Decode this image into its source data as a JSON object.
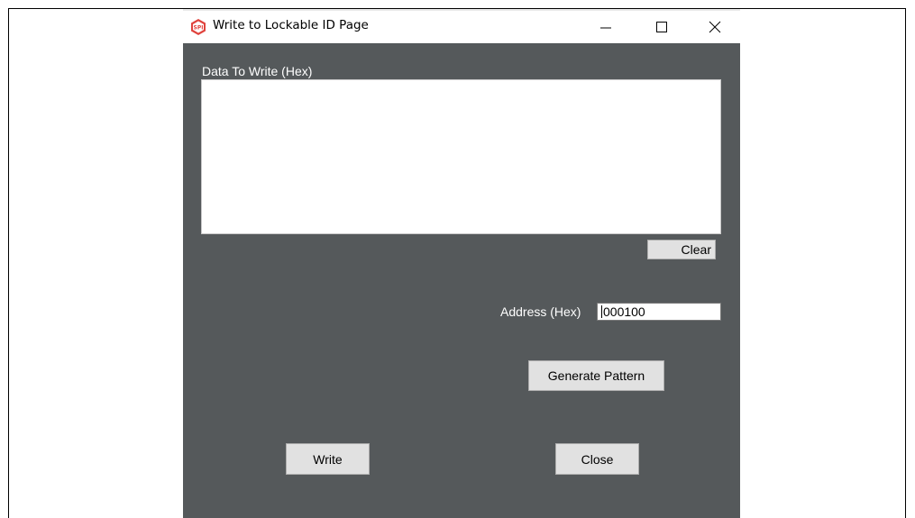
{
  "window": {
    "title": "Write to Lockable ID Page",
    "icon": "spi-hexagon-icon",
    "controls": {
      "minimize": "minimize-icon",
      "maximize": "maximize-icon",
      "close": "close-icon"
    }
  },
  "form": {
    "data_label": "Data To Write (Hex)",
    "data_value": "",
    "clear_label": "Clear",
    "address_label": "Address (Hex)",
    "address_value": "000100",
    "generate_label": "Generate Pattern",
    "write_label": "Write",
    "close_label": "Close"
  },
  "colors": {
    "client_background": "#55595b",
    "button_background": "#e1e1e1",
    "icon_accent": "#e0433d"
  }
}
